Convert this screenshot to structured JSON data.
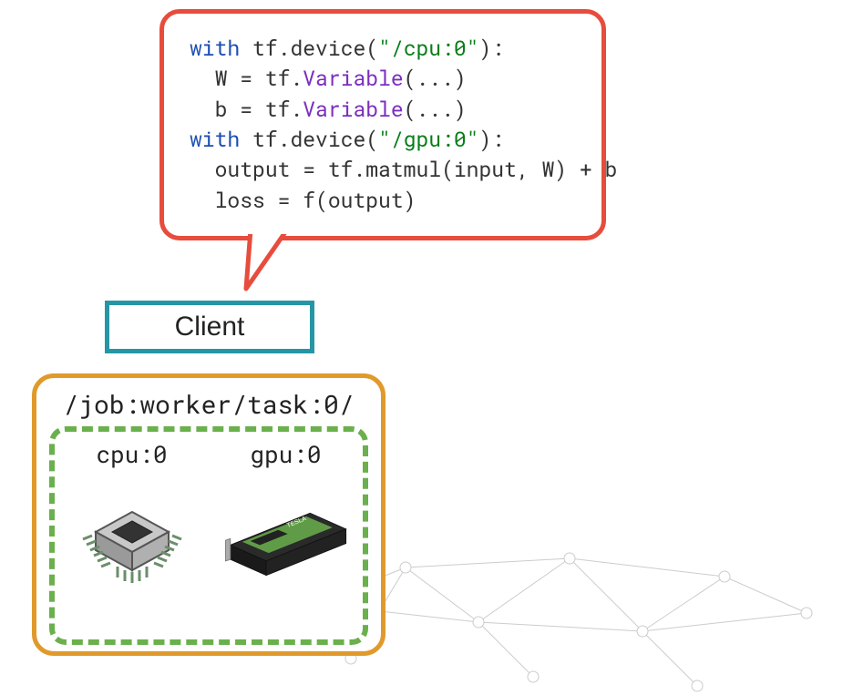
{
  "code": {
    "line1": {
      "with": "with",
      "obj": "tf.",
      "dev": "device",
      "paren": "(",
      "str": "\"/cpu:0\"",
      "close": "):"
    },
    "line2": {
      "indent": "  ",
      "lhs": "W = tf.",
      "fn": "Variable",
      "rest": "(...)"
    },
    "line3": {
      "indent": "  ",
      "lhs": "b = tf.",
      "fn": "Variable",
      "rest": "(...)"
    },
    "line4": {
      "with": "with",
      "obj": "tf.",
      "dev": "device",
      "paren": "(",
      "str": "\"/gpu:0\"",
      "close": "):"
    },
    "line5": {
      "indent": "  ",
      "text": "output = tf.",
      "fn": "matmul",
      "rest": "(input, W) + b"
    },
    "line6": {
      "indent": "  ",
      "text": "loss = ",
      "fn2": "f",
      "rest": "(output)"
    }
  },
  "client": {
    "label": "Client"
  },
  "worker": {
    "title": "/job:worker/task:0/",
    "cpu_label": "cpu:0",
    "gpu_label": "gpu:0"
  }
}
